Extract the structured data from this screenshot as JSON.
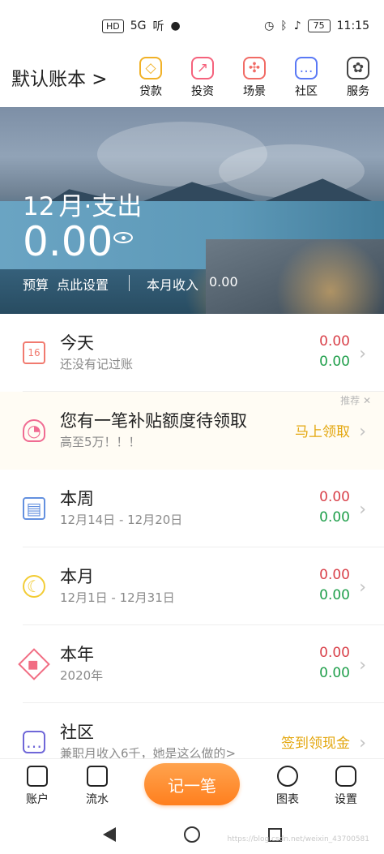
{
  "status_bar": {
    "left_icons": [
      "HD",
      "5G",
      "听"
    ],
    "battery": "75",
    "time": "11:15"
  },
  "header": {
    "book_title": "默认账本 >",
    "menu": [
      {
        "label": "贷款",
        "icon": "loan-icon",
        "color": "#f1b127"
      },
      {
        "label": "投资",
        "icon": "investment-icon",
        "color": "#f5627c"
      },
      {
        "label": "场景",
        "icon": "scene-icon",
        "color": "#f16b65"
      },
      {
        "label": "社区",
        "icon": "community-icon",
        "color": "#5a79f5"
      },
      {
        "label": "服务",
        "icon": "service-icon",
        "color": "#444444"
      }
    ]
  },
  "summary": {
    "month": "12",
    "month_label": "月·支出",
    "expense_amount": "0.00",
    "budget_label": "预算",
    "budget_action": "点此设置",
    "income_label": "本月收入",
    "income_value": "0.00"
  },
  "entries": [
    {
      "title": "今天",
      "subtitle": "还没有记过账",
      "expense": "0.00",
      "income": "0.00",
      "icon": "calendar-icon",
      "icon_color": "#f17a6f"
    },
    {
      "title": "本周",
      "subtitle": "12月14日 - 12月20日",
      "expense": "0.00",
      "income": "0.00",
      "icon": "week-calendar-icon",
      "icon_color": "#6390df"
    },
    {
      "title": "本月",
      "subtitle": "12月1日 - 12月31日",
      "expense": "0.00",
      "income": "0.00",
      "icon": "moon-icon",
      "icon_color": "#f2cc35"
    },
    {
      "title": "本年",
      "subtitle": "2020年",
      "expense": "0.00",
      "income": "0.00",
      "icon": "year-icon",
      "icon_color": "#f16d83"
    },
    {
      "title": "社区",
      "subtitle": "兼职月收入6千，她是这么做的>",
      "action": "签到领现金",
      "icon": "chat-icon",
      "icon_color": "#6f67d8"
    }
  ],
  "promotion": {
    "tag": "推荐 ✕",
    "title": "您有一笔补贴额度待领取",
    "subtitle": "高至5万！！！",
    "action": "马上领取",
    "icon": "wallet-icon",
    "icon_color": "#f06b92"
  },
  "bottom_nav": {
    "items": [
      "账户",
      "流水",
      "图表",
      "设置"
    ],
    "center_button": "记一笔"
  },
  "watermark": "https://blog.csdn.net/weixin_43700581"
}
